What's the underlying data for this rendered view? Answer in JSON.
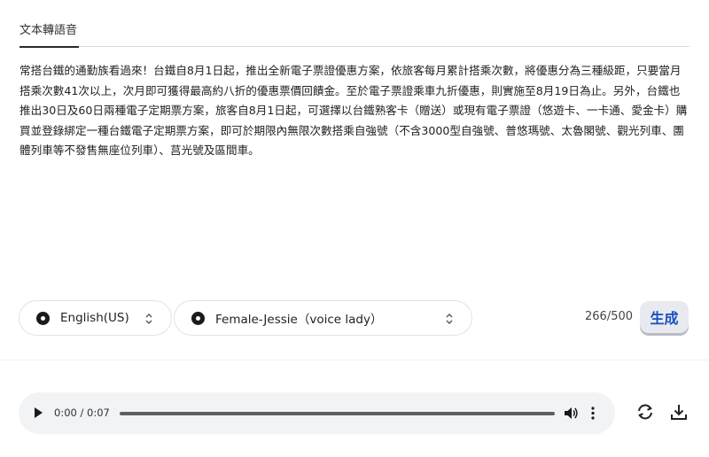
{
  "tab": {
    "label": "文本轉語音"
  },
  "text_content": "常搭台鐵的通勤族看過來！台鐵自8月1日起，推出全新電子票證優惠方案，依旅客每月累計搭乘次數，將優惠分為三種級距，只要當月搭乘次數41次以上，次月即可獲得最高約八折的優惠票價回饋金。至於電子票證乘車九折優惠，則實施至8月19日為止。另外，台鐵也推出30日及60日兩種電子定期票方案，旅客自8月1日起，可選擇以台鐵熟客卡（贈送）或現有電子票證（悠遊卡、一卡通、愛金卡）購買並登錄綁定一種台鐵電子定期票方案，即可於期限內無限次數搭乘自強號（不含3000型自強號、普悠瑪號、太魯閣號、觀光列車、團體列車等不發售無座位列車）、莒光號及區間車。",
  "controls": {
    "language": {
      "selected": "English(US)"
    },
    "voice": {
      "selected": "Female-Jessie（voice lady）"
    },
    "char_count": "266/500",
    "generate_label": "生成"
  },
  "player": {
    "time": "0:00 / 0:07",
    "progress_fraction": 1.0
  },
  "icons": {
    "play": "play-icon",
    "volume": "volume-icon",
    "more": "more-vert-icon",
    "refresh": "refresh-icon",
    "download": "download-icon",
    "chevron": "chevron-up-down-icon"
  },
  "colors": {
    "accent": "#1a4fbf",
    "button_bg": "#e8eaef",
    "player_bg": "#f1f3f4"
  }
}
